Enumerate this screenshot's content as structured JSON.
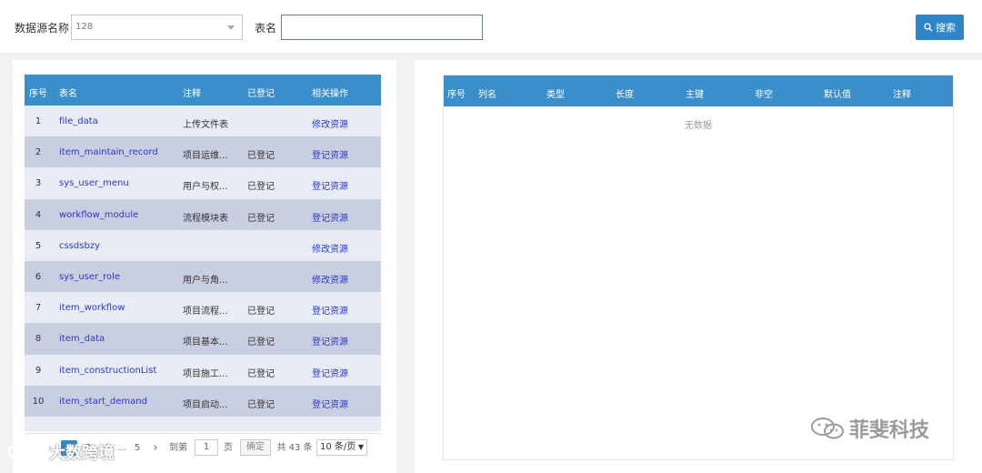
{
  "search": {
    "datasource_label": "数据源名称",
    "datasource_value": "128",
    "table_label": "表名",
    "table_value": "",
    "button_label": "搜索"
  },
  "left_table": {
    "headers": [
      "序号",
      "表名",
      "注释",
      "已登记",
      "相关操作"
    ],
    "rows": [
      {
        "idx": "1",
        "name": "file_data",
        "note": "上传文件表",
        "registered": "",
        "action": "修改资源"
      },
      {
        "idx": "2",
        "name": "item_maintain_record",
        "note": "项目运维...",
        "registered": "已登记",
        "action": "登记资源"
      },
      {
        "idx": "3",
        "name": "sys_user_menu",
        "note": "用户与权...",
        "registered": "已登记",
        "action": "登记资源"
      },
      {
        "idx": "4",
        "name": "workflow_module",
        "note": "流程模块表",
        "registered": "已登记",
        "action": "登记资源"
      },
      {
        "idx": "5",
        "name": "cssdsbzy",
        "note": "",
        "registered": "",
        "action": "修改资源"
      },
      {
        "idx": "6",
        "name": "sys_user_role",
        "note": "用户与角...",
        "registered": "",
        "action": "修改资源"
      },
      {
        "idx": "7",
        "name": "item_workflow",
        "note": "项目流程...",
        "registered": "已登记",
        "action": "登记资源"
      },
      {
        "idx": "8",
        "name": "item_data",
        "note": "项目基本...",
        "registered": "已登记",
        "action": "登记资源"
      },
      {
        "idx": "9",
        "name": "item_constructionList",
        "note": "项目施工...",
        "registered": "已登记",
        "action": "登记资源"
      },
      {
        "idx": "10",
        "name": "item_start_demand",
        "note": "项目启动...",
        "registered": "已登记",
        "action": "登记资源"
      }
    ]
  },
  "pagination": {
    "pages": [
      "1",
      "2",
      "3",
      "...",
      "5"
    ],
    "next": "›",
    "goto_label": "到第",
    "goto_value": "1",
    "page_unit": "页",
    "confirm": "确定",
    "total": "共 43 条",
    "page_size": "10 条/页"
  },
  "right_table": {
    "headers": [
      "序号",
      "列名",
      "类型",
      "长度",
      "主键",
      "非空",
      "默认值",
      "注释"
    ],
    "empty_text": "无数据"
  },
  "watermark": {
    "right": "菲斐科技",
    "left": "大数跨境"
  },
  "colors": {
    "header_blue": "#3a8fca",
    "button_blue": "#2e86c9",
    "row_light": "#e8ecf4",
    "row_dark": "#c9cfe0",
    "link": "#2a37c8"
  }
}
